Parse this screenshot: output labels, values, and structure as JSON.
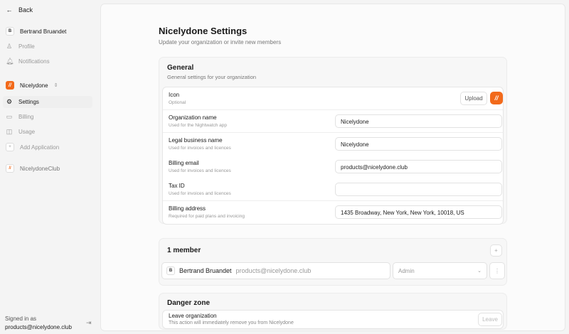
{
  "sidebar": {
    "back": "Back",
    "user": {
      "initial": "B",
      "name": "Bertrand Bruandet"
    },
    "profile": "Profile",
    "notifications": "Notifications",
    "org": "Nicelydone",
    "settings": "Settings",
    "billing": "Billing",
    "usage": "Usage",
    "add_app": "Add Application",
    "club": "NicelydoneClub",
    "signed_in_label": "Signed in as",
    "signed_in_email": "products@nicelydone.club"
  },
  "page": {
    "title": "Nicelydone Settings",
    "subtitle": "Update your organization or invite new members"
  },
  "general": {
    "title": "General",
    "desc": "General settings for your organization",
    "icon": {
      "label": "Icon",
      "sub": "Optional",
      "upload": "Upload"
    },
    "fields": [
      {
        "label": "Organization name",
        "sub": "Used for the Nightwatch app",
        "value": "Nicelydone"
      },
      {
        "label": "Legal business name",
        "sub": "Used for invoices and licences",
        "value": "Nicelydone"
      },
      {
        "label": "Billing email",
        "sub": "Used for invoices and licences",
        "value": "products@nicelydone.club"
      },
      {
        "label": "Tax ID",
        "sub": "Used for invoices and licences",
        "value": ""
      },
      {
        "label": "Billing address",
        "sub": "Required for paid plans and invoicing",
        "value": "1435 Broadway, New York, New York, 10018, US"
      }
    ]
  },
  "members": {
    "title": "1 member",
    "list": [
      {
        "initial": "B",
        "name": "Bertrand Bruandet",
        "email": "products@nicelydone.club",
        "role": "Admin"
      }
    ]
  },
  "danger": {
    "title": "Danger zone",
    "leave_label": "Leave organization",
    "leave_sub": "This action will immediately remove you from Nicelydone",
    "leave_button": "Leave"
  },
  "colors": {
    "accent": "#f26a1b"
  }
}
